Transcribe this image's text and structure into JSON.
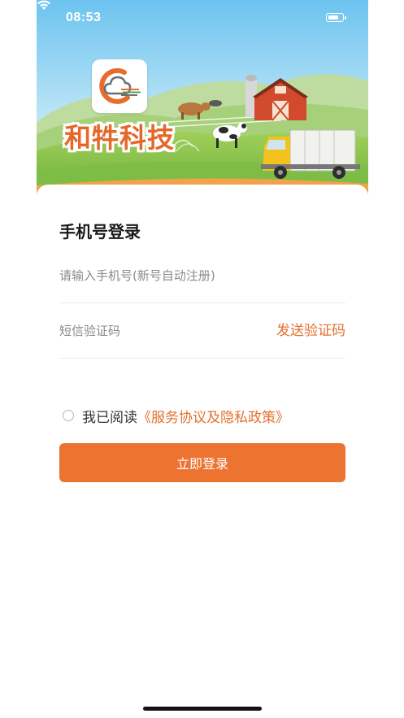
{
  "status_bar": {
    "time": "08:53"
  },
  "hero": {
    "brand_name": "和牪科技"
  },
  "login": {
    "title": "手机号登录",
    "phone_placeholder": "请输入手机号(新号自动注册)",
    "code_placeholder": "短信验证码",
    "send_code_label": "发送验证码",
    "agreement_prefix": "我已阅读",
    "agreement_link": "《服务协议及隐私政策》",
    "submit_label": "立即登录"
  },
  "colors": {
    "accent": "#ec7330",
    "link": "#e4702f",
    "brand": "#e4682a"
  }
}
